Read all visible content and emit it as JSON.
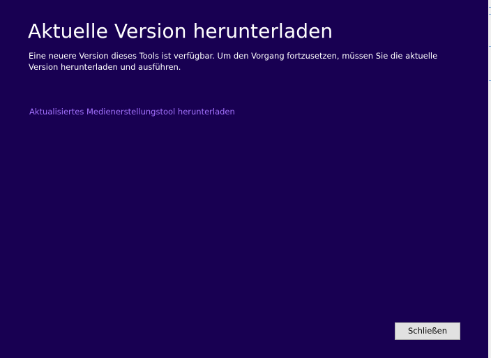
{
  "dialog": {
    "title": "Aktuelle Version herunterladen",
    "description": "Eine neuere Version dieses Tools ist verfügbar. Um den Vorgang fortzusetzen, müssen Sie die aktuelle Version herunterladen und ausführen.",
    "download_link": "Aktualisiertes Medienerstellungstool herunterladen",
    "close_button": "Schließen"
  },
  "colors": {
    "background": "#180052",
    "link": "#a472ff",
    "button_bg": "#e1e1e1"
  }
}
